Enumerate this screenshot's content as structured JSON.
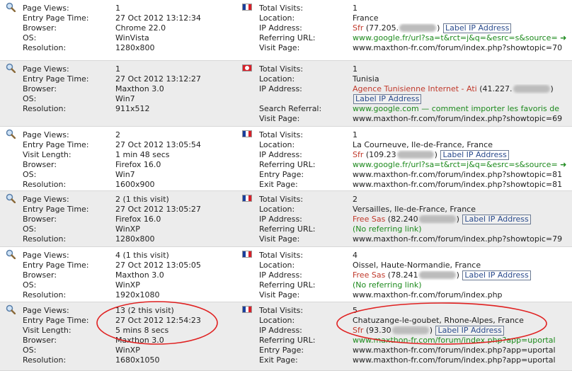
{
  "labels": {
    "page_views": "Page Views:",
    "entry_time": "Entry Page Time:",
    "visit_length": "Visit Length:",
    "browser": "Browser:",
    "os": "OS:",
    "resolution": "Resolution:",
    "total_visits": "Total Visits:",
    "location": "Location:",
    "ip_address": "IP Address:",
    "referring_url": "Referring URL:",
    "search_referral": "Search Referral:",
    "entry_page": "Entry Page:",
    "exit_page": "Exit Page:",
    "visit_page": "Visit Page:",
    "label_ip_button": "Label IP Address"
  },
  "icons": {
    "details": "magnifier-icon",
    "flag_fr": "france-flag-icon",
    "flag_tn": "tunisia-flag-icon"
  },
  "colors": {
    "isp": "#c0392b",
    "url": "#1d8a1d",
    "annotation": "#e02020",
    "alt_row": "#ececec"
  },
  "entries": [
    {
      "flag": "fr",
      "left": [
        {
          "k": "page_views",
          "v": "1"
        },
        {
          "k": "entry_time",
          "v": "27 Oct 2012 13:12:34"
        },
        {
          "k": "browser",
          "v": "Chrome 22.0"
        },
        {
          "k": "os",
          "v": "WinVista"
        },
        {
          "k": "resolution",
          "v": "1280x800"
        }
      ],
      "right": [
        {
          "k": "total_visits",
          "v": "1"
        },
        {
          "k": "location",
          "v": "France"
        },
        {
          "k": "ip_address",
          "isp": "Sfr",
          "ip": "(77.205.",
          "ip_end": ")",
          "btn": true
        },
        {
          "k": "referring_url",
          "v": "www.google.fr/url?sa=t&rct=j&q=&esrc=s&source=",
          "color": "green",
          "arrow": true
        },
        {
          "k": "visit_page",
          "v": "www.maxthon-fr.com/forum/index.php?showtopic=70"
        }
      ]
    },
    {
      "flag": "tn",
      "left": [
        {
          "k": "page_views",
          "v": "1"
        },
        {
          "k": "entry_time",
          "v": "27 Oct 2012 13:12:27"
        },
        {
          "k": "browser",
          "v": "Maxthon 3.0"
        },
        {
          "k": "os",
          "v": "Win7"
        },
        {
          "k": "resolution",
          "v": "911x512"
        }
      ],
      "right": [
        {
          "k": "total_visits",
          "v": "1"
        },
        {
          "k": "location",
          "v": "Tunisia"
        },
        {
          "k": "ip_address",
          "isp": "Agence Tunisienne Internet - Ati",
          "ip": "(41.227.",
          "ip_end": ")"
        },
        {
          "k": "",
          "btn": true
        },
        {
          "k": "search_referral",
          "v": "www.google.com — comment importer les favoris de",
          "color": "green"
        },
        {
          "k": "visit_page",
          "v": "www.maxthon-fr.com/forum/index.php?showtopic=69"
        }
      ]
    },
    {
      "flag": "fr",
      "left": [
        {
          "k": "page_views",
          "v": "2"
        },
        {
          "k": "entry_time",
          "v": "27 Oct 2012 13:05:54"
        },
        {
          "k": "visit_length",
          "v": "1 min 48 secs"
        },
        {
          "k": "browser",
          "v": "Firefox 16.0"
        },
        {
          "k": "os",
          "v": "Win7"
        },
        {
          "k": "resolution",
          "v": "1600x900"
        }
      ],
      "right": [
        {
          "k": "total_visits",
          "v": "1"
        },
        {
          "k": "location",
          "v": "La Courneuve, Ile-de-France, France"
        },
        {
          "k": "ip_address",
          "isp": "Sfr",
          "ip": "(109.23",
          "ip_end": ")",
          "btn": true
        },
        {
          "k": "referring_url",
          "v": "www.google.fr/url?sa=t&rct=j&q=&esrc=s&source=",
          "color": "green",
          "arrow": true
        },
        {
          "k": "entry_page",
          "v": "www.maxthon-fr.com/forum/index.php?showtopic=81"
        },
        {
          "k": "exit_page",
          "v": "www.maxthon-fr.com/forum/index.php?showtopic=81"
        }
      ]
    },
    {
      "flag": "fr",
      "left": [
        {
          "k": "page_views",
          "v": "2 (1 this visit)"
        },
        {
          "k": "entry_time",
          "v": "27 Oct 2012 13:05:27"
        },
        {
          "k": "browser",
          "v": "Firefox 16.0"
        },
        {
          "k": "os",
          "v": "WinXP"
        },
        {
          "k": "resolution",
          "v": "1280x800"
        }
      ],
      "right": [
        {
          "k": "total_visits",
          "v": "2"
        },
        {
          "k": "location",
          "v": "Versailles, Ile-de-France, France"
        },
        {
          "k": "ip_address",
          "isp": "Free Sas",
          "ip": "(82.240",
          "ip_end": ")",
          "btn": true
        },
        {
          "k": "referring_url",
          "v": "(No referring link)",
          "color": "green"
        },
        {
          "k": "visit_page",
          "v": "www.maxthon-fr.com/forum/index.php?showtopic=79"
        }
      ]
    },
    {
      "flag": "fr",
      "left": [
        {
          "k": "page_views",
          "v": "4 (1 this visit)"
        },
        {
          "k": "entry_time",
          "v": "27 Oct 2012 13:05:05"
        },
        {
          "k": "browser",
          "v": "Maxthon 3.0"
        },
        {
          "k": "os",
          "v": "WinXP"
        },
        {
          "k": "resolution",
          "v": "1920x1080"
        }
      ],
      "right": [
        {
          "k": "total_visits",
          "v": "4"
        },
        {
          "k": "location",
          "v": "Oissel, Haute-Normandie, France"
        },
        {
          "k": "ip_address",
          "isp": "Free Sas",
          "ip": "(78.241",
          "ip_end": ")",
          "btn": true
        },
        {
          "k": "referring_url",
          "v": "(No referring link)",
          "color": "green"
        },
        {
          "k": "visit_page",
          "v": "www.maxthon-fr.com/forum/index.php"
        }
      ]
    },
    {
      "flag": "fr",
      "left": [
        {
          "k": "page_views",
          "v": "13 (2 this visit)"
        },
        {
          "k": "entry_time",
          "v": "27 Oct 2012 12:54:23"
        },
        {
          "k": "visit_length",
          "v": "5 mins 8 secs"
        },
        {
          "k": "browser",
          "v": "Maxthon 3.0"
        },
        {
          "k": "os",
          "v": "WinXP"
        },
        {
          "k": "resolution",
          "v": "1680x1050"
        }
      ],
      "right": [
        {
          "k": "total_visits",
          "v": "5"
        },
        {
          "k": "location",
          "v": "Chatuzange-le-goubet, Rhone-Alpes, France"
        },
        {
          "k": "ip_address",
          "isp": "Sfr",
          "ip": "(93.30",
          "ip_end": ")",
          "btn": true
        },
        {
          "k": "referring_url",
          "v": "www.maxthon-fr.com/forum/index.php?app=uportal",
          "color": "green"
        },
        {
          "k": "entry_page",
          "v": "www.maxthon-fr.com/forum/index.php?app=uportal"
        },
        {
          "k": "exit_page",
          "v": "www.maxthon-fr.com/forum/index.php?app=uportal"
        }
      ]
    }
  ]
}
